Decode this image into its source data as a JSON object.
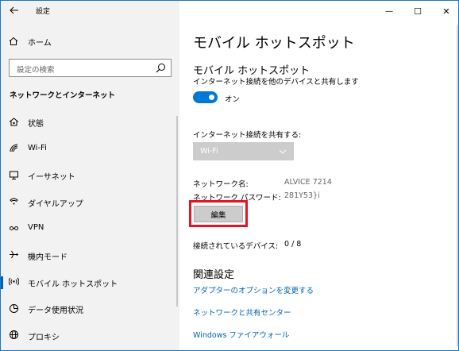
{
  "window": {
    "app_title": "設定",
    "controls": {
      "minimize": "—",
      "maximize": "☐",
      "close": "✕"
    }
  },
  "sidebar": {
    "home_label": "ホーム",
    "search_placeholder": "設定の検索",
    "section_heading": "ネットワークとインターネット",
    "items": [
      {
        "label": "状態",
        "icon": "home-network-icon"
      },
      {
        "label": "Wi-Fi",
        "icon": "wifi-icon"
      },
      {
        "label": "イーサネット",
        "icon": "ethernet-icon"
      },
      {
        "label": "ダイヤルアップ",
        "icon": "dialup-icon"
      },
      {
        "label": "VPN",
        "icon": "vpn-icon"
      },
      {
        "label": "機内モード",
        "icon": "airplane-icon"
      },
      {
        "label": "モバイル ホットスポット",
        "icon": "hotspot-icon",
        "active": true
      },
      {
        "label": "データ使用状況",
        "icon": "data-usage-icon"
      },
      {
        "label": "プロキシ",
        "icon": "globe-icon"
      }
    ]
  },
  "main": {
    "page_title": "モバイル ホットスポット",
    "hotspot": {
      "title": "モバイル ホットスポット",
      "description": "インターネット接続を他のデバイスと共有します",
      "toggle_state": "オン",
      "toggle_on": true
    },
    "share": {
      "label": "インターネット接続を共有する:",
      "selected": "Wi-Fi"
    },
    "network_name": {
      "label": "ネットワーク名:",
      "value": "ALVICE 7214"
    },
    "network_password": {
      "label": "ネットワーク パスワード:",
      "value": "281Y53}i"
    },
    "edit_label": "編集",
    "connected": {
      "label": "接続されているデバイス:",
      "value": "0 / 8"
    },
    "related": {
      "title": "関連設定",
      "links": [
        "アダプターのオプションを変更する",
        "ネットワークと共有センター",
        "Windows ファイアウォール"
      ]
    }
  },
  "colors": {
    "accent": "#0078d7",
    "link": "#0063b1",
    "highlight": "#e81123",
    "sidebar_bg": "#f2f2f2"
  }
}
